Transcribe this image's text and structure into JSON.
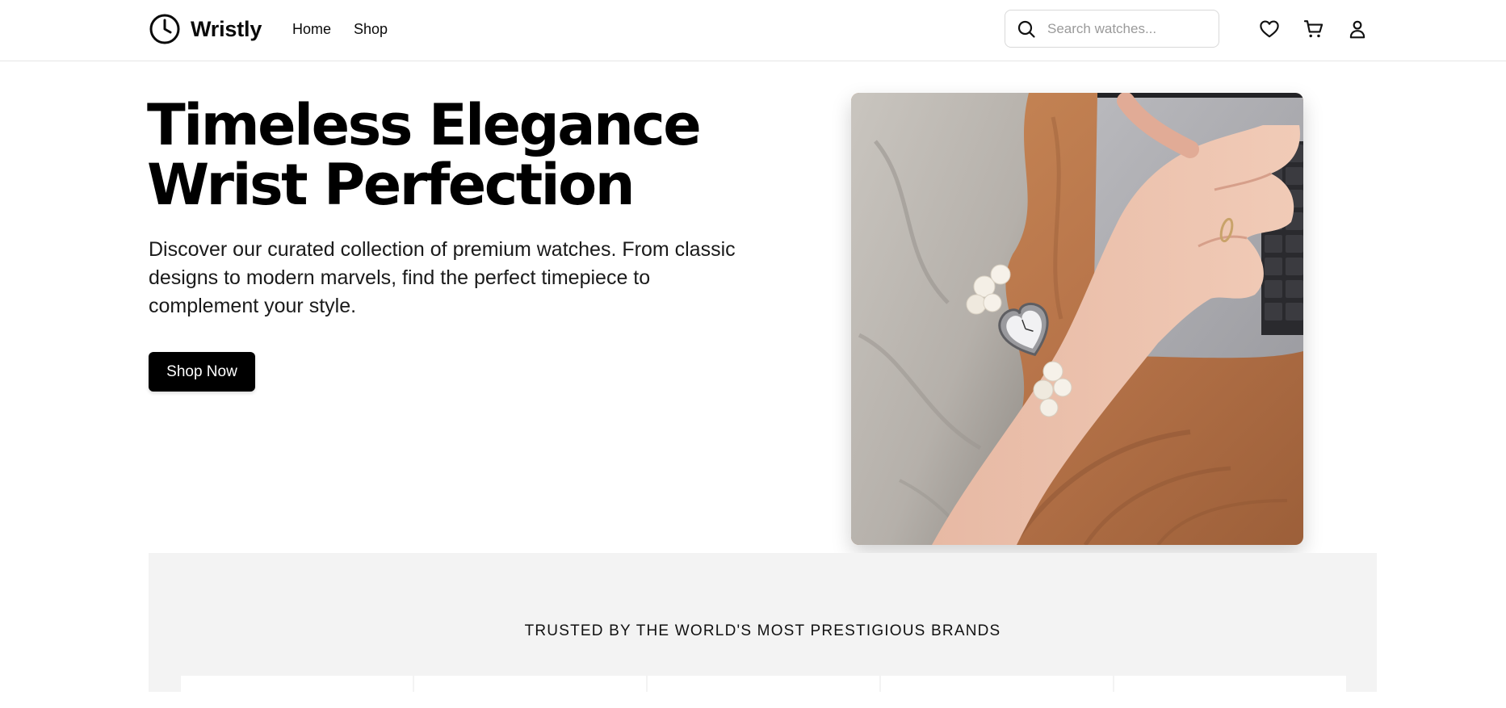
{
  "nav": {
    "brand_name": "Wristly",
    "logo_icon": "clock-icon",
    "links": [
      {
        "label": "Home"
      },
      {
        "label": "Shop"
      }
    ],
    "search": {
      "placeholder": "Search watches...",
      "value": "",
      "icon": "search-icon"
    },
    "actions": [
      {
        "icon": "heart-icon",
        "label": "Wishlist"
      },
      {
        "icon": "cart-icon",
        "label": "Cart"
      },
      {
        "icon": "user-icon",
        "label": "Account"
      }
    ]
  },
  "hero": {
    "title_line1": "Timeless Elegance",
    "title_line2": "Wrist Perfection",
    "description": "Discover our curated collection of premium watches. From classic designs to modern marvels, find the perfect timepiece to complement your style.",
    "cta_label": "Shop Now",
    "image_subject": "wrist-with-pearl-heart-watch-on-laptop"
  },
  "brands": {
    "heading": "TRUSTED BY THE WORLD'S MOST PRESTIGIOUS BRANDS",
    "cards": [
      "",
      "",
      "",
      "",
      ""
    ]
  },
  "colors": {
    "primary": "#000000",
    "background": "#ffffff",
    "section_bg": "#f3f3f3",
    "border": "#e5e5e5"
  }
}
